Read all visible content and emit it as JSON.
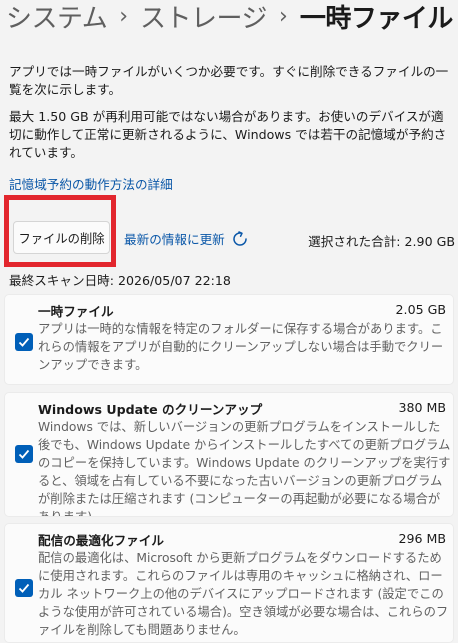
{
  "breadcrumb": [
    "システム",
    "ストレージ",
    "一時ファイル"
  ],
  "intro": "アプリでは一時ファイルがいくつか必要です。すぐに削除できるファイルの一覧を次に示します。",
  "reserved": "最大 1.50 GB が再利用可能ではない場合があります。お使いのデバイスが適切に動作して正常に更新されるように、Windows では若干の記憶域が予約されています。",
  "reserved_link": "記憶域予約の動作方法の詳細",
  "toolbar": {
    "delete_label": "ファイルの削除",
    "refresh_label": "最新の情報に更新",
    "total": "選択された合計: 2.90 GB"
  },
  "last_scan": "最終スキャン日時: 2026/05/07 22:18",
  "items": [
    {
      "title": "一時ファイル",
      "size": "2.05 GB",
      "checked": true,
      "description": "アプリは一時的な情報を特定のフォルダーに保存する場合があります。これらの情報をアプリが自動的にクリーンアップしない場合は手動でクリーンアップできます。"
    },
    {
      "title": "Windows Update のクリーンアップ",
      "size": "380 MB",
      "checked": true,
      "description": "Windows では、新しいバージョンの更新プログラムをインストールした後でも、Windows Update からインストールしたすべての更新プログラムのコピーを保持しています。Windows Update のクリーンアップを実行すると、領域を占有している不要になった古いバージョンの更新プログラムが削除または圧縮されます (コンピューターの再起動が必要になる場合があります)。"
    },
    {
      "title": "配信の最適化ファイル",
      "size": "296 MB",
      "checked": true,
      "description": "配信の最適化は、Microsoft から更新プログラムをダウンロードするために使用されます。これらのファイルは専用のキャッシュに格納され、ローカル ネットワーク上の他のデバイスにアップロードされます (設定でこのような使用が許可されている場合)。空き領域が必要な場合は、これらのファイルを削除しても問題ありません。"
    }
  ],
  "colors": {
    "accent": "#005fb8",
    "link": "#0a57a8",
    "highlight": "#e2262d"
  }
}
